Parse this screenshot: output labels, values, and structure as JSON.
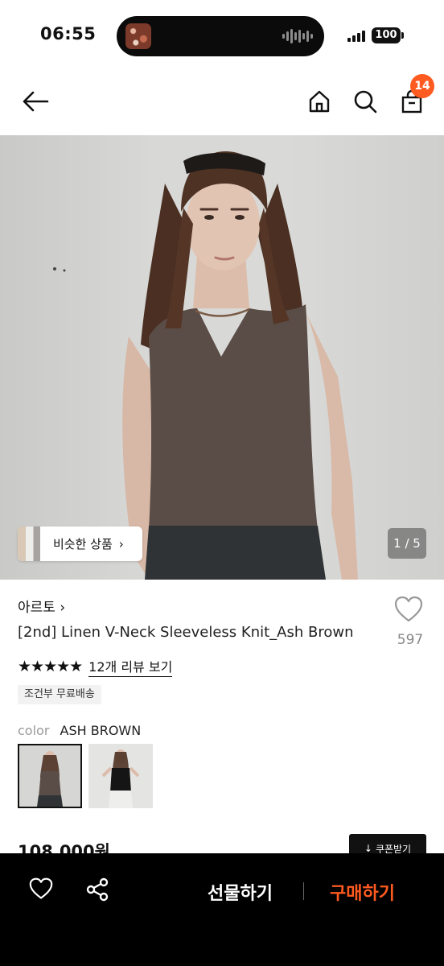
{
  "status_bar": {
    "time": "06:55",
    "battery": "100"
  },
  "nav": {
    "cart_count": "14"
  },
  "gallery": {
    "similar_label": "비슷한 상품",
    "counter": "1 / 5"
  },
  "product": {
    "brand": "아르토",
    "name": "[2nd] Linen V-Neck Sleeveless Knit_Ash Brown",
    "like_count": "597",
    "stars": "★★★★★",
    "rating_value": 5,
    "review_link": "12개 리뷰 보기",
    "shipping_badge": "조건부 무료배송",
    "color_label": "color",
    "color_value": "ASH BROWN",
    "price": "108,000원",
    "coupon_label": "쿠폰받기"
  },
  "bottom_bar": {
    "gift_label": "선물하기",
    "buy_label": "구매하기"
  },
  "colors": {
    "accent": "#ff5a1f",
    "bottom_bar_bg": "#000000"
  },
  "icons": [
    "back-arrow-icon",
    "home-icon",
    "search-icon",
    "shopping-bag-icon",
    "heart-icon",
    "share-icon",
    "download-arrow-icon"
  ]
}
